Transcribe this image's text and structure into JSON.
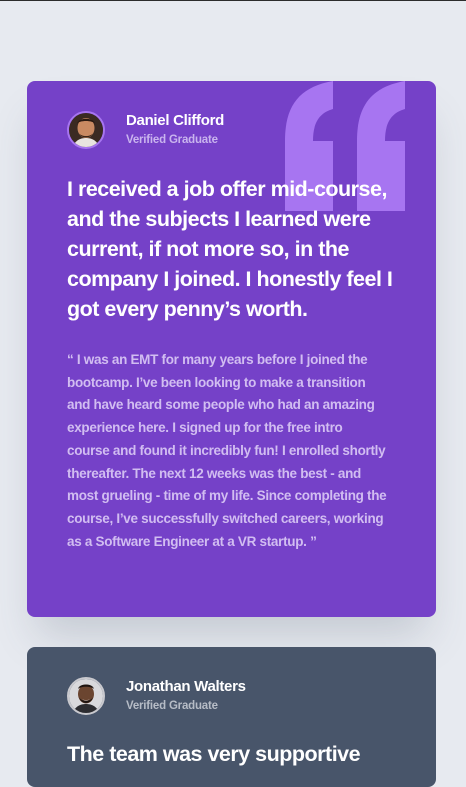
{
  "colors": {
    "page_background": "#e7eaf0",
    "card_1_background": "#7541c8",
    "card_2_background": "#48556a",
    "quote_mark": "#a775f1",
    "heading_text": "#ffffff"
  },
  "testimonials": [
    {
      "name": "Daniel Clifford",
      "role": "Verified Graduate",
      "headline": "I received a job offer mid-course, and the subjects I learned were current, if not more so, in the company I joined. I honestly feel I got every penny’s worth.",
      "body": "“ I was an EMT for many years before I joined the bootcamp. I’ve been looking to make a transition and have heard some people who had an amazing experience here. I signed up for the free intro course and found it incredibly fun! I enrolled shortly thereafter. The next 12 weeks was the best - and most grueling - time of my life. Since completing the course, I’ve successfully switched careers, working as a Software Engineer at a VR startup. ”",
      "avatar_icon": "person-portrait-icon",
      "decoration_icon": "quotation-mark-icon"
    },
    {
      "name": "Jonathan Walters",
      "role": "Verified Graduate",
      "headline": "The team was very supportive",
      "avatar_icon": "person-portrait-icon"
    }
  ]
}
